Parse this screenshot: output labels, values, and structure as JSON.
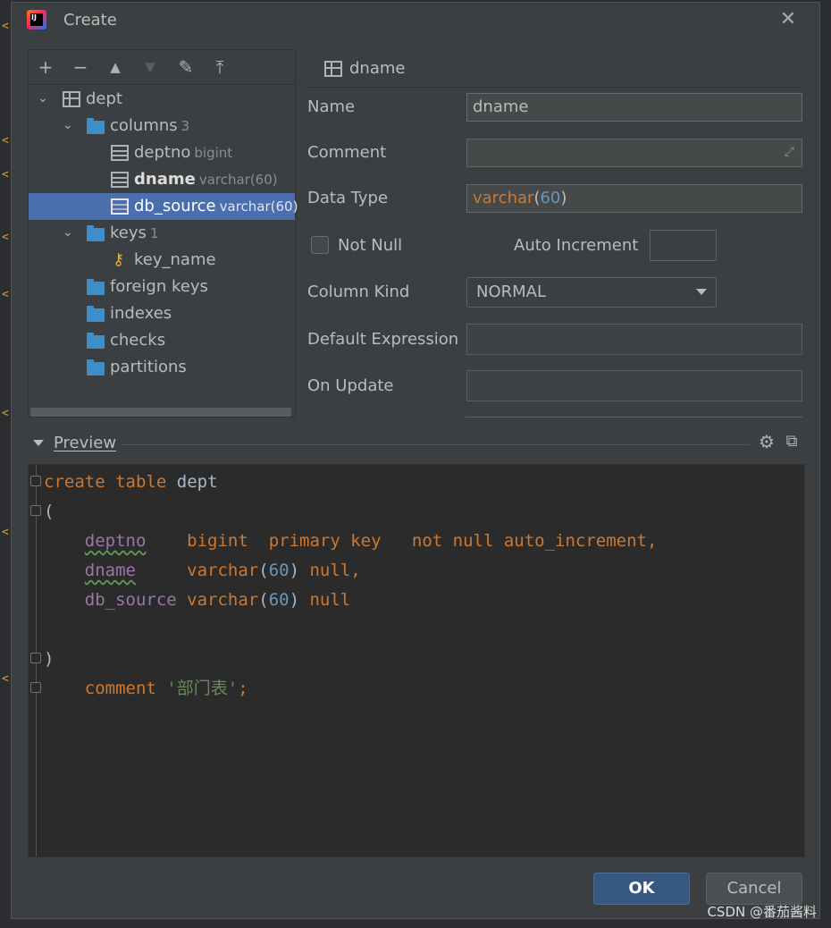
{
  "dialog": {
    "title": "Create",
    "ok_label": "OK",
    "cancel_label": "Cancel"
  },
  "toolbar": {
    "add": "+",
    "remove": "−",
    "up": "▲",
    "down": "▼",
    "edit": "✎",
    "move_top": "⤒"
  },
  "tree": {
    "table": {
      "name": "dept"
    },
    "columns_group": {
      "label": "columns",
      "count": "3"
    },
    "columns": [
      {
        "name": "deptno",
        "type": "bigint"
      },
      {
        "name": "dname",
        "type": "varchar(60)"
      },
      {
        "name": "db_source",
        "type": "varchar(60)"
      }
    ],
    "keys_group": {
      "label": "keys",
      "count": "1"
    },
    "keys": [
      {
        "name": "key_name"
      }
    ],
    "other_groups": [
      "foreign keys",
      "indexes",
      "checks",
      "partitions"
    ]
  },
  "detail": {
    "header": "dname",
    "name_label": "Name",
    "name_value": "dname",
    "comment_label": "Comment",
    "comment_value": "",
    "datatype_label": "Data Type",
    "datatype_keyword": "varchar",
    "datatype_open": "(",
    "datatype_size": "60",
    "datatype_close": ")",
    "not_null_label": "Not Null",
    "auto_increment_label": "Auto Increment",
    "column_kind_label": "Column Kind",
    "column_kind_value": "NORMAL",
    "default_expression_label": "Default Expression",
    "on_update_label": "On Update"
  },
  "preview": {
    "label": "Preview",
    "lines": {
      "l1_k1": "create",
      "l1_k2": "table",
      "l1_t": "dept",
      "l2": "(",
      "c1_name": "deptno",
      "c1_type": "bigint",
      "c1_pk": "primary key",
      "c1_rest": "not null auto_increment,",
      "c2_name": "dname",
      "c2_type": "varchar",
      "c2_size": "60",
      "c2_rest": "null,",
      "c3_name": "db_source",
      "c3_type": "varchar",
      "c3_size": "60",
      "c3_rest": "null",
      "close": ")",
      "comment_kw": "comment",
      "comment_str": "'部门表'",
      "semi": ";"
    }
  },
  "watermark": "CSDN @番茄酱料",
  "colors": {
    "selection": "#4b6eaf",
    "ok_button": "#365880",
    "keyword": "#cc7832",
    "number": "#6897bb",
    "field_name": "#9876aa"
  }
}
